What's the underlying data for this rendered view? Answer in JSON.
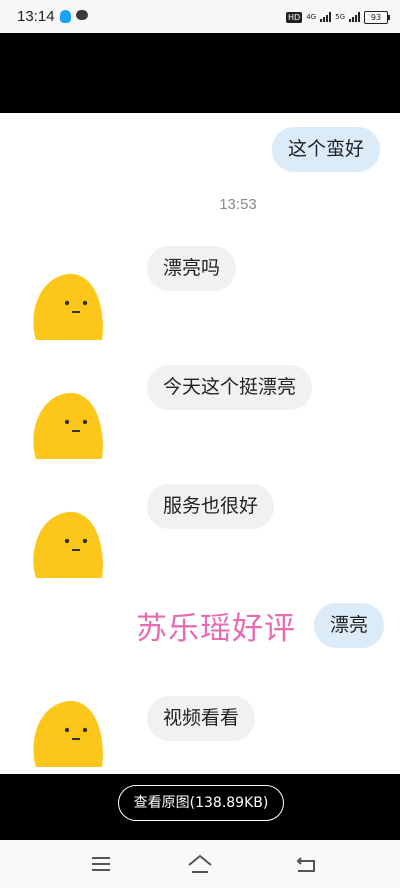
{
  "status_bar": {
    "time": "13:14",
    "hd_label": "HD",
    "net_label_1": "4G",
    "net_label_2": "5G",
    "battery": "93"
  },
  "chat": {
    "messages": [
      {
        "side": "right",
        "text": "这个蛮好"
      },
      {
        "side": "left",
        "text": "漂亮吗"
      },
      {
        "side": "left",
        "text": "今天这个挺漂亮"
      },
      {
        "side": "left",
        "text": "服务也很好"
      },
      {
        "side": "right",
        "text": "漂亮"
      },
      {
        "side": "left",
        "text": "视频看看"
      }
    ],
    "timestamp": "13:53"
  },
  "watermark": "苏乐瑶好评",
  "viewer": {
    "view_original": "查看原图(138.89KB)"
  },
  "colors": {
    "bubble_left": "#f1f1f1",
    "bubble_right": "#dcebf8",
    "watermark": "#e76bb1",
    "avatar": "#fcc71a"
  }
}
